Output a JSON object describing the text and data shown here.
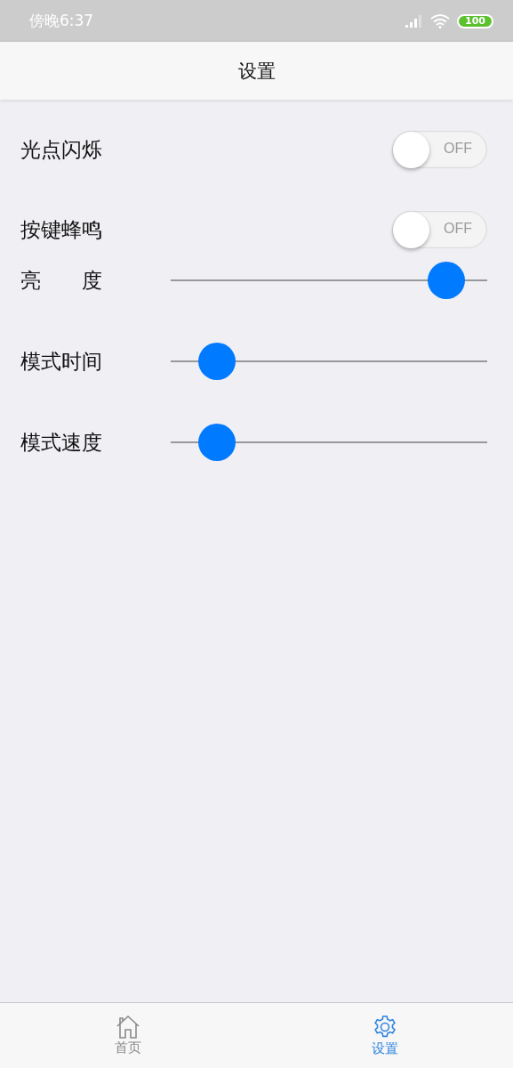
{
  "status_bar": {
    "time": "傍晚6:37",
    "battery": "100"
  },
  "header": {
    "title": "设置"
  },
  "settings": [
    {
      "kind": "toggle",
      "label": "光点闪烁",
      "on": false,
      "state_text": "OFF"
    },
    {
      "kind": "toggle",
      "label": "按键蜂鸣",
      "on": false,
      "state_text": "OFF"
    },
    {
      "kind": "slider",
      "label": "亮　　度",
      "level": 0.92
    },
    {
      "kind": "slider",
      "label": "模式时间",
      "level": 0.1
    },
    {
      "kind": "slider",
      "label": "模式速度",
      "level": 0.1
    }
  ],
  "tab_bar": [
    {
      "kind": "home",
      "label": "首页",
      "selected": false
    },
    {
      "kind": "settings",
      "label": "设置",
      "selected": true
    }
  ]
}
